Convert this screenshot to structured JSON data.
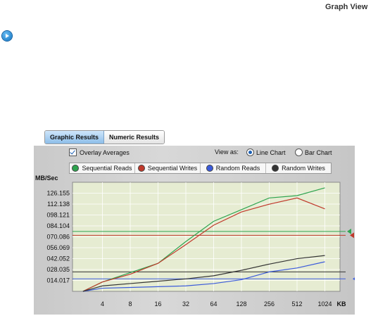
{
  "page": {
    "title": "Graph View"
  },
  "tabs": [
    {
      "label": "Graphic Results",
      "active": true
    },
    {
      "label": "Numeric Results",
      "active": false
    }
  ],
  "controls": {
    "overlay_label": "Overlay Averages",
    "overlay_checked": true,
    "view_as_label": "View as:",
    "line_chart_label": "Line Chart",
    "bar_chart_label": "Bar Chart",
    "selected_view": "Line Chart"
  },
  "legend": [
    {
      "label": "Sequential Reads",
      "color": "#2ea44f",
      "icon": "green-circle-icon"
    },
    {
      "label": "Sequential Writes",
      "color": "#c0392b",
      "icon": "red-circle-icon"
    },
    {
      "label": "Random Reads",
      "color": "#3b5bdb",
      "icon": "blue-circle-icon"
    },
    {
      "label": "Random Writes",
      "color": "#333333",
      "icon": "black-circle-icon"
    }
  ],
  "chart_data": {
    "type": "line",
    "ylabel": "MB/Sec",
    "xlabel": "KB",
    "x": [
      "4",
      "8",
      "16",
      "32",
      "64",
      "128",
      "256",
      "512",
      "1024"
    ],
    "yticks": [
      "126.155",
      "112.138",
      "098.121",
      "084.104",
      "070.086",
      "056.069",
      "042.052",
      "028.035",
      "014.017"
    ],
    "ylim": [
      0,
      140.17
    ],
    "series": [
      {
        "name": "Sequential Reads",
        "color": "#2ea44f",
        "start": 0,
        "values": [
          12,
          24,
          36,
          64,
          90,
          105,
          120,
          123,
          133
        ]
      },
      {
        "name": "Sequential Writes",
        "color": "#c0392b",
        "start": 0,
        "values": [
          12,
          22,
          36,
          60,
          85,
          102,
          112,
          120,
          106
        ]
      },
      {
        "name": "Random Reads",
        "color": "#3b5bdb",
        "start": 0,
        "values": [
          4,
          5,
          6,
          7,
          10,
          15,
          25,
          30,
          38
        ]
      },
      {
        "name": "Random Writes",
        "color": "#333333",
        "start": 0,
        "values": [
          7,
          10,
          13,
          16,
          20,
          27,
          35,
          42,
          46
        ]
      }
    ],
    "averages": [
      {
        "series": "Sequential Reads",
        "color": "#2ea44f",
        "value": 77
      },
      {
        "series": "Sequential Writes",
        "color": "#c0392b",
        "value": 72
      },
      {
        "series": "Random Writes",
        "color": "#333333",
        "value": 25
      },
      {
        "series": "Random Reads",
        "color": "#3b5bdb",
        "value": 16
      }
    ],
    "grid": true,
    "plot_background": "#e6ecd2"
  }
}
